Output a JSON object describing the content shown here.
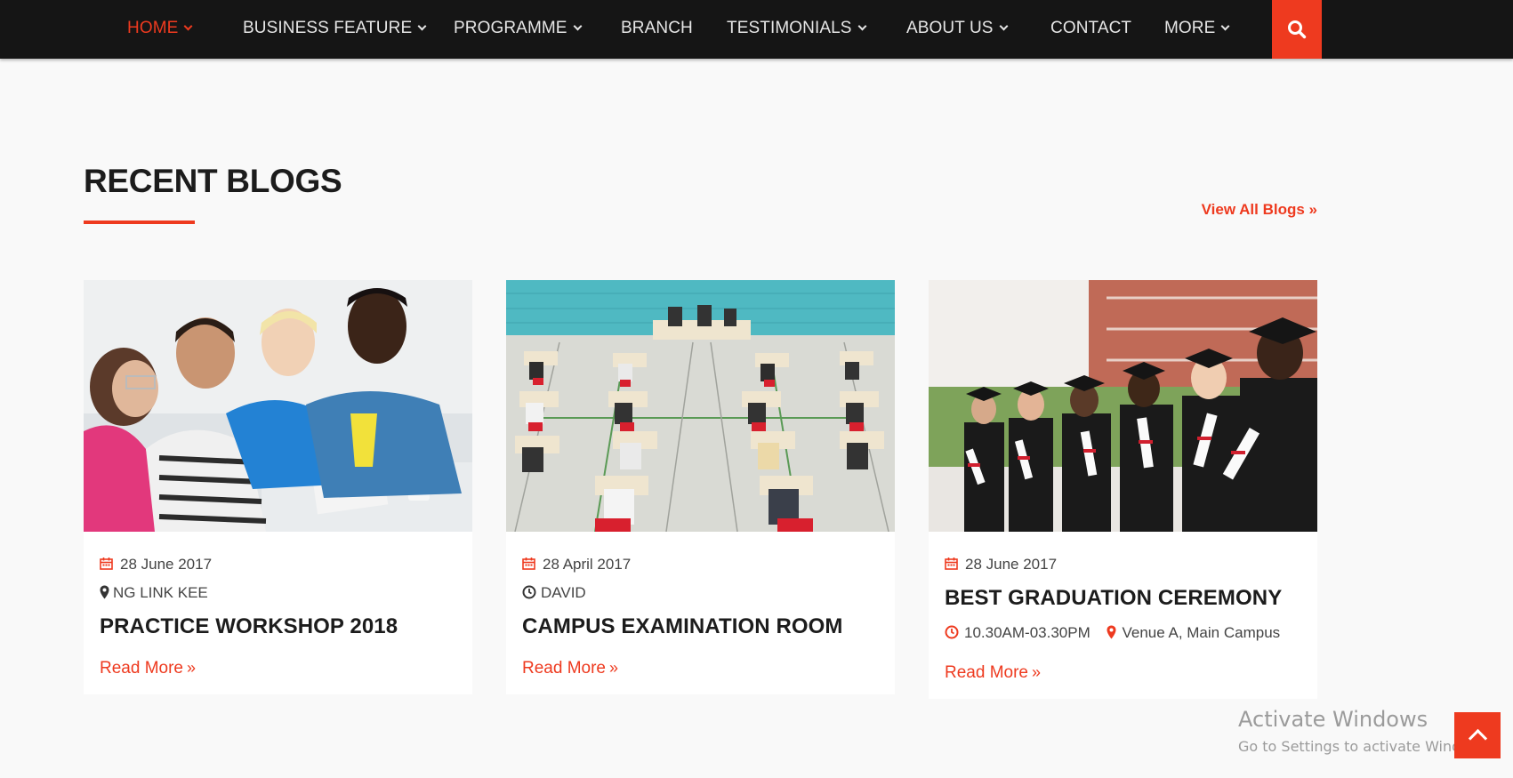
{
  "nav": {
    "items": [
      {
        "label": "HOME",
        "has_dropdown": true,
        "active": true
      },
      {
        "label": "BUSINESS FEATURE",
        "has_dropdown": true
      },
      {
        "label": "PROGRAMME",
        "has_dropdown": true
      },
      {
        "label": "BRANCH",
        "has_dropdown": false
      },
      {
        "label": "TESTIMONIALS",
        "has_dropdown": true
      },
      {
        "label": "ABOUT US",
        "has_dropdown": true
      },
      {
        "label": "CONTACT",
        "has_dropdown": false
      },
      {
        "label": "MORE",
        "has_dropdown": true
      }
    ],
    "search_icon": "search-icon"
  },
  "section": {
    "title": "RECENT BLOGS",
    "view_all": "View All Blogs »"
  },
  "cards": [
    {
      "date": "28 June 2017",
      "author": "NG LINK KEE",
      "author_icon": "map-marker-icon",
      "title": "PRACTICE WORKSHOP 2018",
      "read_more": "Read More",
      "image": "students-at-desk-photo"
    },
    {
      "date": "28 April 2017",
      "author": "DAVID",
      "author_icon": "clock-icon",
      "title": "CAMPUS EXAMINATION ROOM",
      "read_more": "Read More",
      "image": "exam-hall-photo"
    },
    {
      "date": "28 June 2017",
      "title": "BEST GRADUATION CEREMONY",
      "time": "10.30AM-03.30PM",
      "venue": "Venue A, Main Campus",
      "read_more": "Read More",
      "image": "graduates-photo"
    }
  ],
  "watermark": {
    "title": "Activate Windows",
    "subtitle": "Go to Settings to activate Windows."
  },
  "colors": {
    "accent": "#ee3a1f",
    "nav_bg": "#151515",
    "page_bg": "#f9f9f9"
  }
}
